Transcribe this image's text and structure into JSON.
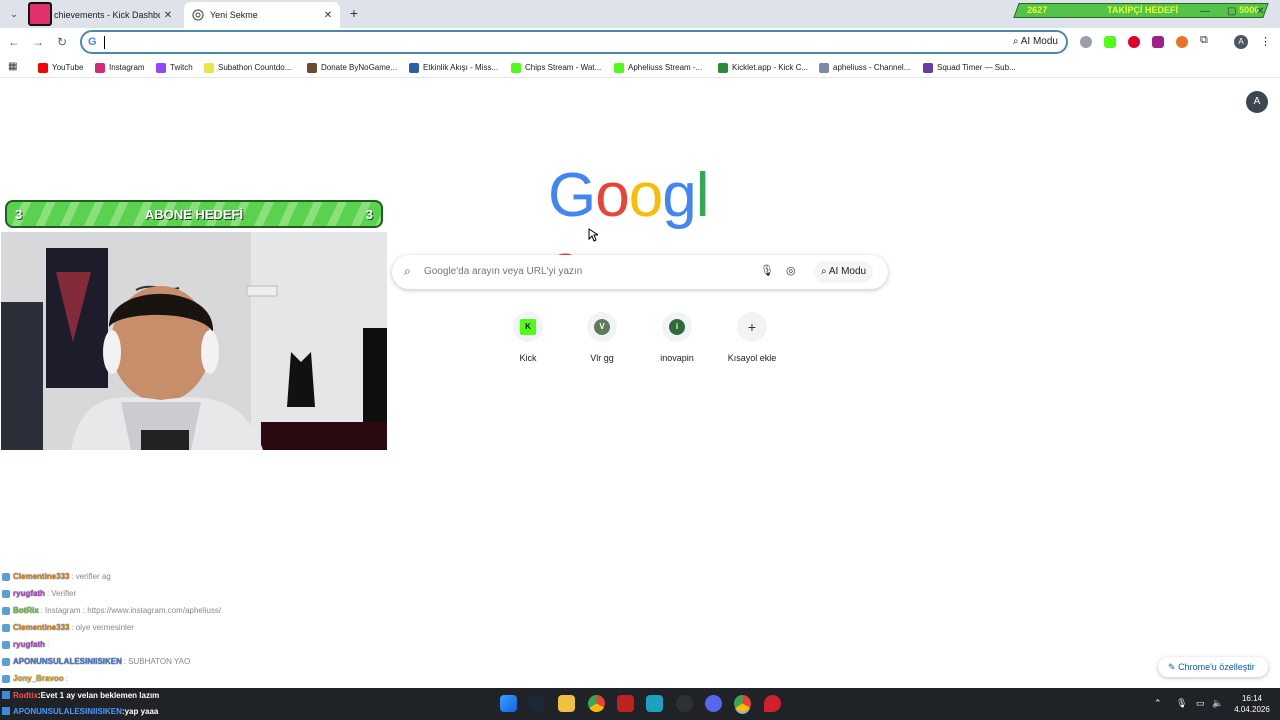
{
  "tabs": [
    {
      "title": "chievements - Kick Dashboard",
      "close": "✕"
    },
    {
      "title": "Yeni Sekme",
      "close": "✕"
    }
  ],
  "new_tab_label": "+",
  "follower_goal": {
    "current": "2627",
    "title": "TAKİPÇİ HEDEFİ",
    "target": "5000"
  },
  "window_controls": {
    "minimize": "—",
    "maximize": "▢",
    "close": "✕"
  },
  "omnibox": {
    "value": "",
    "ai_mode_label": "AI Modu"
  },
  "profile_initial": "A",
  "bookmarks": [
    {
      "label": "YouTube",
      "color": "#ff0000"
    },
    {
      "label": "Instagram",
      "color": "#d62976"
    },
    {
      "label": "Twitch",
      "color": "#9146ff"
    },
    {
      "label": "Subathon Countdo...",
      "color": "#e8e64a"
    },
    {
      "label": "Donate ByNoGame...",
      "color": "#6b4b2a"
    },
    {
      "label": "Etkinlik Akışı - Miss...",
      "color": "#2f5aa8"
    },
    {
      "label": "Chips Stream - Wat...",
      "color": "#53fc18"
    },
    {
      "label": "Apheliuss Stream -...",
      "color": "#53fc18"
    },
    {
      "label": "Kicklet.app - Kick C...",
      "color": "#2a8a3a"
    },
    {
      "label": "apheliuss - Channel...",
      "color": "#7a8aa8"
    },
    {
      "label": "Squad Timer — Sub...",
      "color": "#6a3aa8"
    }
  ],
  "account_initial": "A",
  "google_logo": "Google",
  "search": {
    "placeholder": "Google'da arayın veya URL'yi yazın",
    "ai_mode_label": "AI Modu"
  },
  "shortcuts": [
    {
      "label": "Kick",
      "glyph": "K",
      "color": "#53fc18"
    },
    {
      "label": "Vlr gg",
      "glyph": "V",
      "color": "#5d7a5d"
    },
    {
      "label": "inovapin",
      "glyph": "i",
      "color": "#2f6a3a"
    },
    {
      "label": "Kısayol ekle",
      "glyph": "+",
      "color": "#f1f3f4"
    }
  ],
  "customize_label": "Chrome'u özelleştir",
  "sub_goal": {
    "current": "3",
    "title": "ABONE HEDEFİ",
    "target": "3"
  },
  "chat": [
    {
      "user": "Clementine333",
      "user_color": "#d98a2a",
      "msg": "verifler ag"
    },
    {
      "user": "ryugfath",
      "user_color": "#b04ad8",
      "msg": "Verifler"
    },
    {
      "user": "BotRix",
      "user_color": "#6ac438",
      "msg": "Instagram : https://www.instagram.com/apheliuss/"
    },
    {
      "user": "Clementine333",
      "user_color": "#d98a2a",
      "msg": "oiye vermesinler"
    },
    {
      "user": "ryugfath",
      "user_color": "#b04ad8",
      "msg": ""
    },
    {
      "user": "APONUNSULALESINIISIKEN",
      "user_color": "#4a7ad8",
      "msg": "SUBHATON YAO"
    },
    {
      "user": "Jony_Bravoo",
      "user_color": "#d8a82a",
      "msg": ""
    }
  ],
  "taskbar_chat": [
    {
      "user": "Rodtix",
      "user_color": "#ff5050",
      "msg": "Evet 1 ay velan beklemen lazım"
    },
    {
      "user": "APONUNSULALESINIISIKEN",
      "user_color": "#4a9aff",
      "msg": "yap yaaa"
    }
  ],
  "clock": {
    "time": "16:14",
    "date": "4.04.2026"
  }
}
